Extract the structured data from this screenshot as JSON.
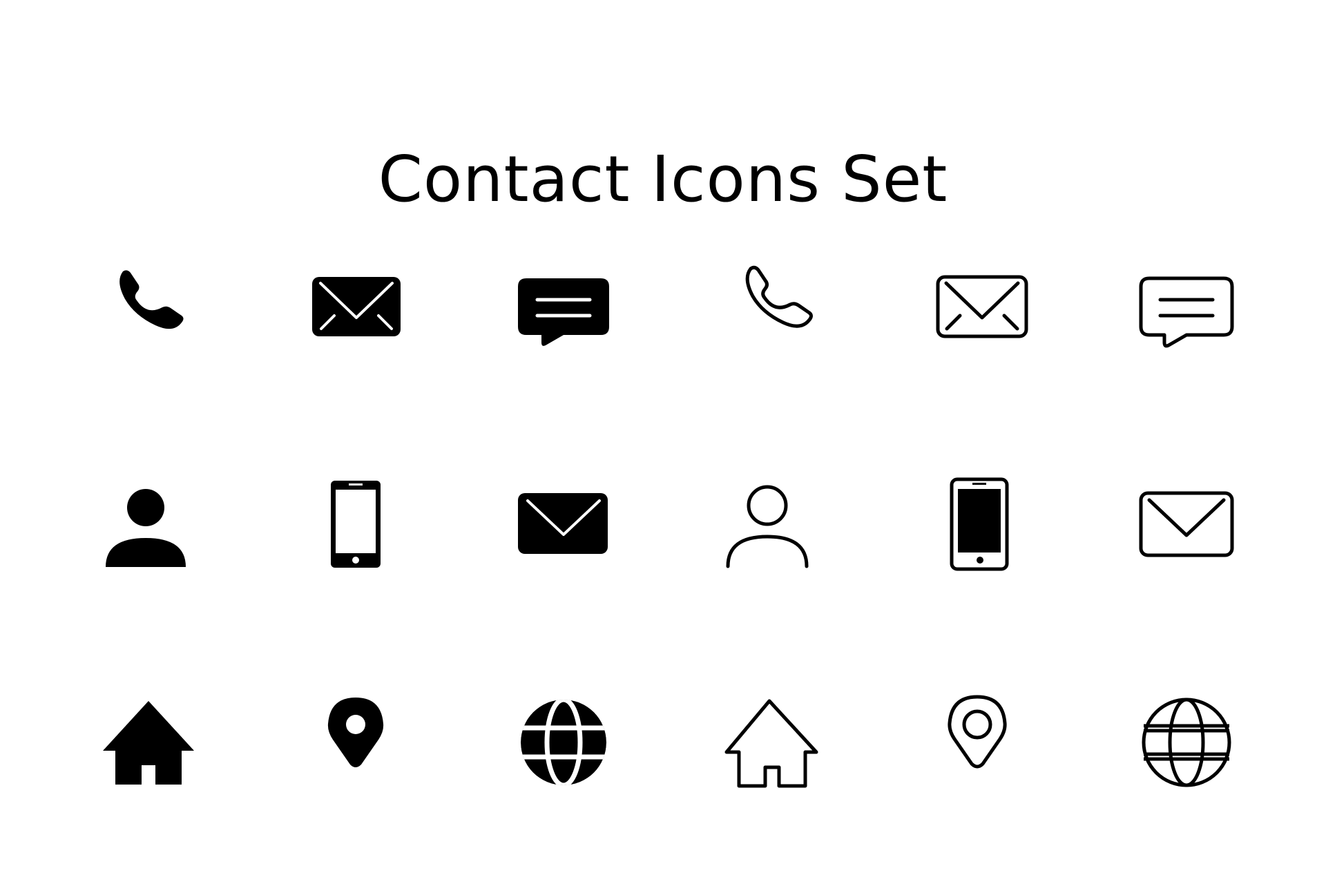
{
  "title": "Contact Icons Set",
  "ink_color": "#000000",
  "background_color": "#ffffff",
  "icons": [
    {
      "name": "phone-icon",
      "style": "filled"
    },
    {
      "name": "envelope-icon",
      "style": "filled"
    },
    {
      "name": "chat-bubble-icon",
      "style": "filled"
    },
    {
      "name": "phone-icon",
      "style": "outline"
    },
    {
      "name": "envelope-icon",
      "style": "outline"
    },
    {
      "name": "chat-bubble-icon",
      "style": "outline"
    },
    {
      "name": "user-icon",
      "style": "filled"
    },
    {
      "name": "smartphone-icon",
      "style": "outline"
    },
    {
      "name": "envelope-icon",
      "style": "filled"
    },
    {
      "name": "user-icon",
      "style": "outline"
    },
    {
      "name": "smartphone-icon",
      "style": "filled"
    },
    {
      "name": "envelope-icon",
      "style": "outline"
    },
    {
      "name": "home-icon",
      "style": "filled"
    },
    {
      "name": "location-pin-icon",
      "style": "filled"
    },
    {
      "name": "globe-icon",
      "style": "filled"
    },
    {
      "name": "home-icon",
      "style": "outline"
    },
    {
      "name": "location-pin-icon",
      "style": "outline"
    },
    {
      "name": "globe-icon",
      "style": "outline"
    }
  ]
}
